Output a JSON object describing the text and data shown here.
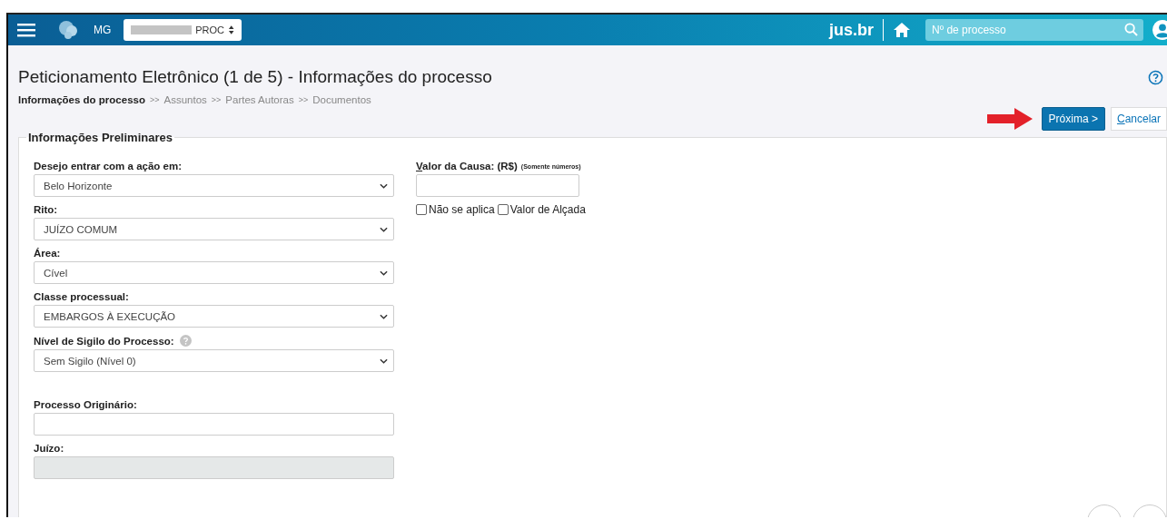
{
  "header": {
    "region": "MG",
    "profile_select": "PROC",
    "logo_text": "jus.br",
    "search": {
      "placeholder": "Nº de processo"
    }
  },
  "page": {
    "title": "Peticionamento Eletrônico (1 de 5) - Informações do processo",
    "steps": [
      {
        "label": "Informações do processo",
        "selected": true
      },
      {
        "label": "Assuntos",
        "selected": false
      },
      {
        "label": "Partes Autoras",
        "selected": false
      },
      {
        "label": "Documentos",
        "selected": false
      }
    ],
    "step_separator": ">>",
    "buttons": {
      "next": "Próxima >",
      "cancel": "Cancelar"
    }
  },
  "section": {
    "legend": "Informações Preliminares",
    "fields": [
      {
        "kind": "select",
        "label": "Desejo entrar com a ação em:",
        "value": "Belo Horizonte",
        "help": false
      },
      {
        "kind": "select",
        "label": "Rito:",
        "value": "JUÍZO COMUM",
        "help": false
      },
      {
        "kind": "select",
        "label": "Área:",
        "value": "Cível",
        "help": false
      },
      {
        "kind": "select",
        "label": "Classe processual:",
        "value": "EMBARGOS À EXECUÇÃO",
        "help": false
      },
      {
        "kind": "select",
        "label": "Nível de Sigilo do Processo:",
        "value": "Sem Sigilo (Nível 0)",
        "help": true
      }
    ],
    "origin_fields": [
      {
        "kind": "input",
        "label": "Processo Originário:"
      },
      {
        "kind": "disabled",
        "label": "Juízo:"
      }
    ],
    "value_field": {
      "label": "Valor da Causa: (R$)",
      "note": "(Somente números)"
    },
    "options": [
      {
        "label": "Não se aplica",
        "checked": false
      },
      {
        "label": "Valor de Alçada",
        "checked": false
      }
    ]
  }
}
